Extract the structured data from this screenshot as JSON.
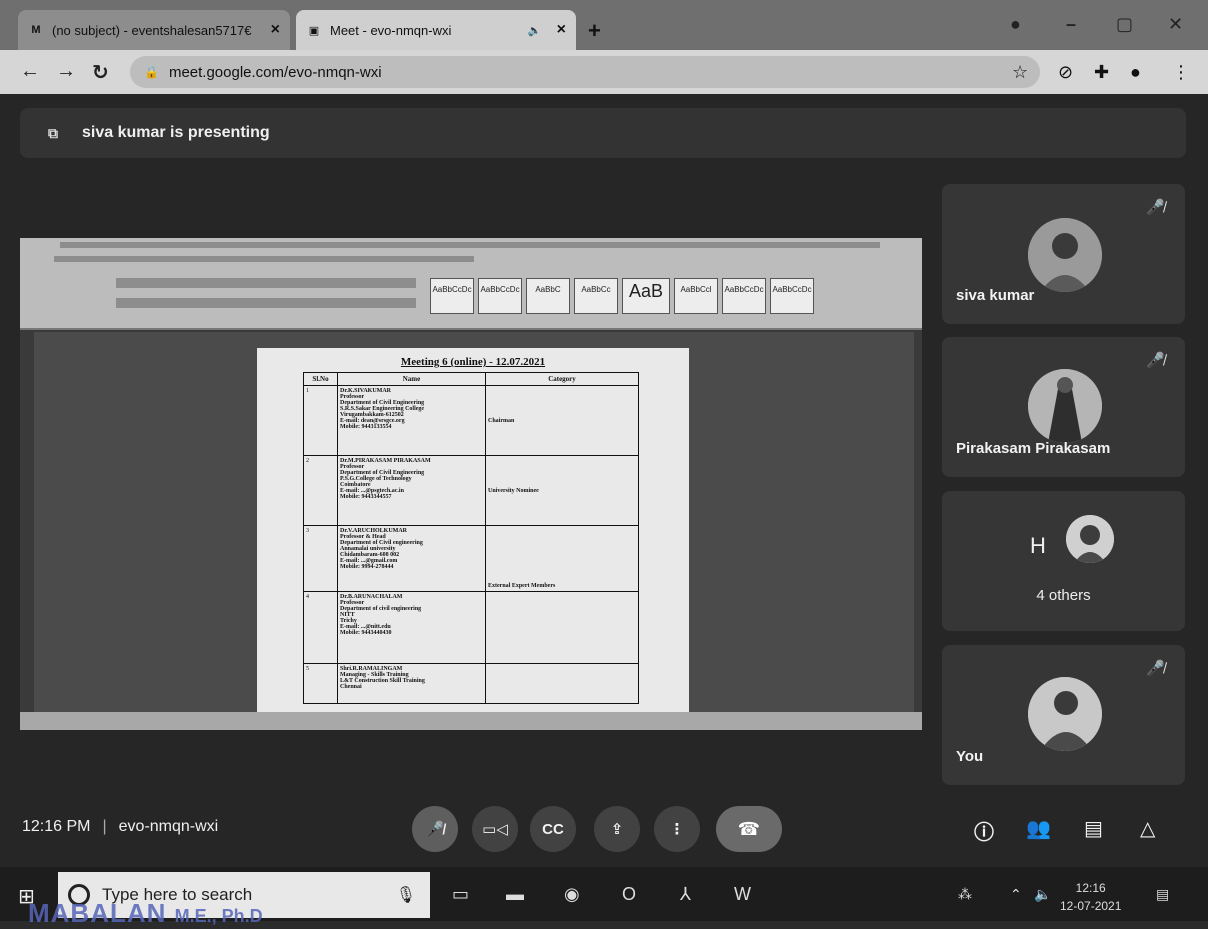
{
  "browser": {
    "tabs": [
      {
        "title": "(no subject) - eventshalesan5717€",
        "close": "×"
      },
      {
        "title": "Meet - evo-nmqn-wxi",
        "close": "×",
        "audio": "🔈"
      }
    ],
    "new_tab": "+",
    "url": "meet.google.com/evo-nmqn-wxi"
  },
  "meet": {
    "banner": "siva kumar is presenting",
    "meeting_time": "12:16 PM",
    "meeting_code": "evo-nmqn-wxi",
    "document": {
      "title": "Meeting 6 (online) - 12.07.2021",
      "columns": [
        "Sl.No",
        "Name",
        "Category"
      ],
      "rows": [
        {
          "no": "1",
          "name": "Dr.K.SIVAKUMAR\nProfessor\nDepartment of Civil Engineering\nS.R.S.Sakar Engineering College\nVirugambakkam-612502\nE-mail: dean@srsgce.org\nMobile: 9443133554",
          "category": "Chairman"
        },
        {
          "no": "2",
          "name": "Dr.M.PIRAKASAM PIRAKASAM\nProfessor\nDepartment of Civil Engineering\nP.S.G.College of Technology\nCoimbatore\nE-mail: ...@psgtech.ac.in\nMobile: 9443344557",
          "category": "University Nominee"
        },
        {
          "no": "3",
          "name": "Dr.V.ARUCHOLKUMAR\nProfessor & Head\nDepartment of Civil engineering\nAnnamalai university\nChidambaram-608 002\nE-mail: ...@gmail.com\nMobile: 9994-278444",
          "category": "External Expert Members"
        },
        {
          "no": "4",
          "name": "Dr.B.ARUNACHALAM\nProfessor\nDepartment of civil engineering\nNITT\nTrichy\nE-mail: ...@nitt.edu\nMobile: 9443440430",
          "category": ""
        },
        {
          "no": "5",
          "name": "Shri.R.RAMALINGAM\nManaging - Skills Training\nL&T Construction Skill Training\nChennai",
          "category": ""
        }
      ]
    },
    "participants": [
      {
        "name": "siva kumar"
      },
      {
        "name": "Pirakasam Pirakasam"
      },
      {
        "initial": "H",
        "label": "4 others"
      },
      {
        "name": "You"
      }
    ]
  },
  "taskbar": {
    "search_placeholder": "Type here to search",
    "time": "12:16",
    "date": "12-07-2021"
  },
  "overlay_stamp": {
    "name": "MABALAN",
    "degrees": "M.E., Ph.D"
  }
}
